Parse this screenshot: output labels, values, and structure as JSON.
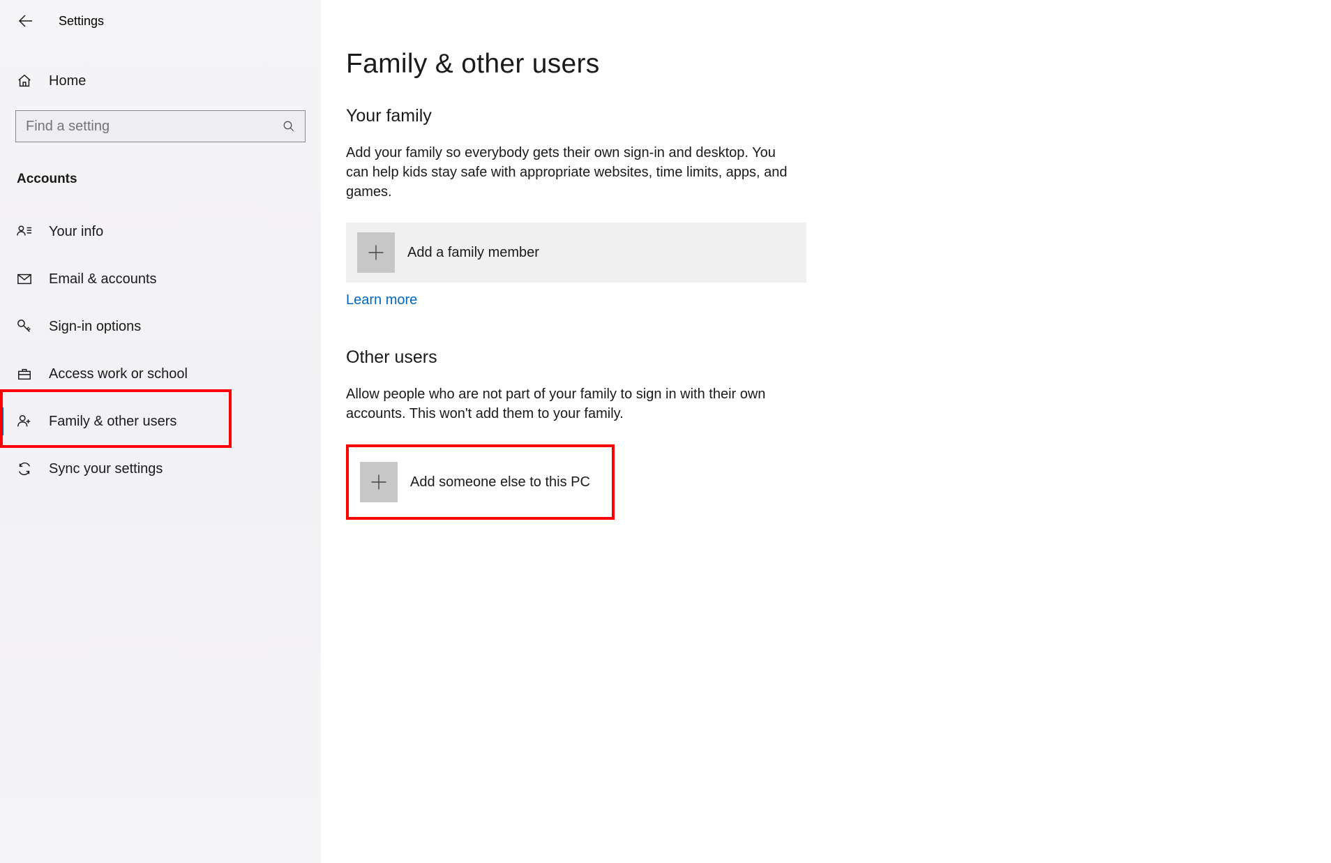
{
  "header": {
    "title": "Settings"
  },
  "sidebar": {
    "home_label": "Home",
    "search_placeholder": "Find a setting",
    "section_title": "Accounts",
    "items": [
      {
        "label": "Your info"
      },
      {
        "label": "Email & accounts"
      },
      {
        "label": "Sign-in options"
      },
      {
        "label": "Access work or school"
      },
      {
        "label": "Family & other users"
      },
      {
        "label": "Sync your settings"
      }
    ]
  },
  "main": {
    "title": "Family & other users",
    "family": {
      "heading": "Your family",
      "desc": "Add your family so everybody gets their own sign-in and desktop. You can help kids stay safe with appropriate websites, time limits, apps, and games.",
      "add_label": "Add a family member",
      "learn_more": "Learn more"
    },
    "other": {
      "heading": "Other users",
      "desc": "Allow people who are not part of your family to sign in with their own accounts. This won't add them to your family.",
      "add_label": "Add someone else to this PC"
    }
  }
}
